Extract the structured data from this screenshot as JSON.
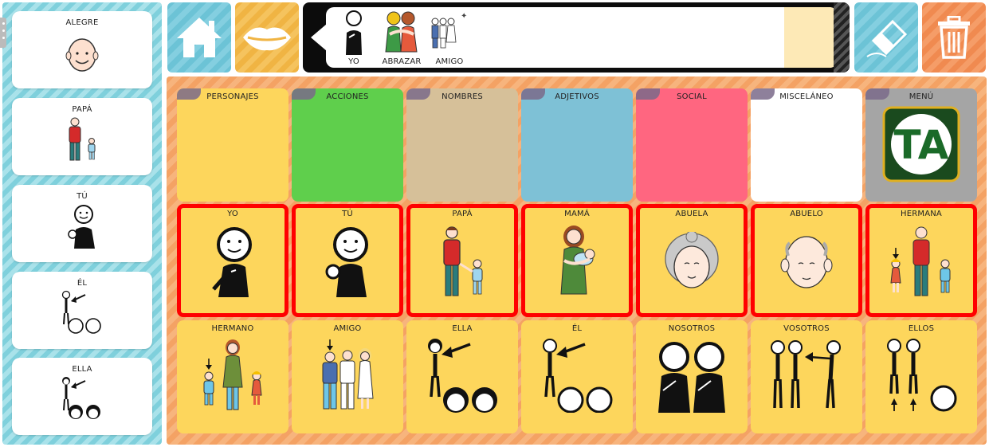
{
  "sidebar": {
    "items": [
      {
        "label": "ALEGRE"
      },
      {
        "label": "PAPÁ"
      },
      {
        "label": "TÚ"
      },
      {
        "label": "ÉL"
      },
      {
        "label": "ELLA"
      }
    ]
  },
  "toolbar": {
    "home": "home-icon",
    "speak": "lips-icon",
    "erase": "eraser-icon",
    "delete": "trash-icon"
  },
  "message": {
    "words": [
      {
        "label": "YO"
      },
      {
        "label": "ABRAZAR"
      },
      {
        "label": "AMIGO"
      }
    ]
  },
  "categories": [
    {
      "label": "PERSONAJES",
      "color": "#fdd65c"
    },
    {
      "label": "ACCIONES",
      "color": "#5fcf4c"
    },
    {
      "label": "NOMBRES",
      "color": "#d6c099"
    },
    {
      "label": "ADJETIVOS",
      "color": "#7ec1d6"
    },
    {
      "label": "SOCIAL",
      "color": "#ff6680"
    },
    {
      "label": "MISCELÁNEO",
      "color": "#ffffff"
    },
    {
      "label": "MENÚ",
      "color": "#a5a5a5",
      "logo": "TA"
    }
  ],
  "row2": [
    {
      "label": "YO"
    },
    {
      "label": "TÚ"
    },
    {
      "label": "PAPÁ"
    },
    {
      "label": "MAMÁ"
    },
    {
      "label": "ABUELA"
    },
    {
      "label": "ABUELO"
    },
    {
      "label": "HERMANA"
    }
  ],
  "row3": [
    {
      "label": "HERMANO"
    },
    {
      "label": "AMIGO"
    },
    {
      "label": "ELLA"
    },
    {
      "label": "ÉL"
    },
    {
      "label": "NOSOTROS"
    },
    {
      "label": "VOSOTROS"
    },
    {
      "label": "ELLOS"
    }
  ]
}
